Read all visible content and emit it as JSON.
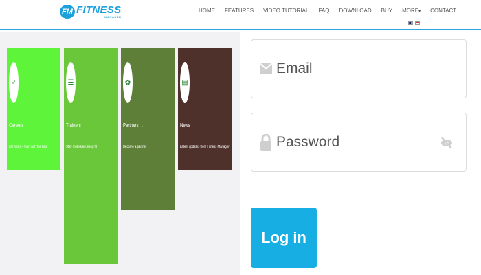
{
  "brand": {
    "badge": "FM",
    "title": "FITNESS",
    "subtitle": "MANAGER"
  },
  "nav": {
    "items": [
      "HOME",
      "FEATURES",
      "VIDEO TUTORIAL",
      "FAQ",
      "DOWNLOAD",
      "BUY",
      "MORE",
      "CONTACT"
    ]
  },
  "languages": [
    "English",
    "Serbian"
  ],
  "tiles": [
    {
      "title": "Careers →",
      "desc": "Lift hunts – train with the best",
      "color": "#5ef43a",
      "icon": "dumbbell-icon"
    },
    {
      "title": "Trainers →",
      "desc": "Stay motivated, keep fit",
      "color": "#6bc73a",
      "icon": "clipboard-icon"
    },
    {
      "title": "Partners →",
      "desc": "Become a partner",
      "color": "#5d7f37",
      "icon": "handshake-icon"
    },
    {
      "title": "News →",
      "desc": "Latest updates from Fitness Manager",
      "color": "#4f312c",
      "icon": "newspaper-icon"
    }
  ],
  "form": {
    "email_placeholder": "Email",
    "password_placeholder": "Password",
    "login_label": "Log in"
  },
  "colors": {
    "accent": "#17aee3",
    "header_line": "#2aa6dd"
  }
}
